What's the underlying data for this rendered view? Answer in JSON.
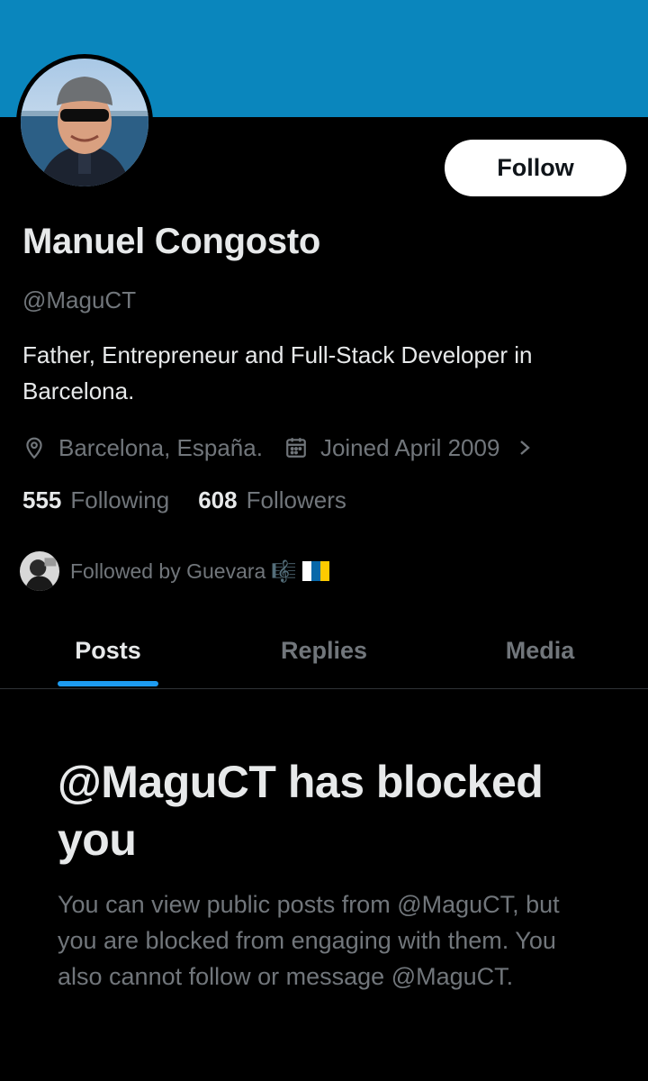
{
  "colors": {
    "banner": "#0a86bd",
    "accent": "#1d9bf0",
    "text_primary": "#e7e9ea",
    "text_secondary": "#71767b",
    "background": "#000000"
  },
  "profile": {
    "name": "Manuel Congosto",
    "handle": "@MaguCT",
    "bio": "Father, Entrepreneur and Full-Stack Developer in Barcelona.",
    "location_icon": "location-pin-icon",
    "location": "Barcelona, España.",
    "joined_icon": "calendar-icon",
    "joined": "Joined April 2009",
    "follow_label": "Follow"
  },
  "stats": {
    "following_count": "555",
    "following_label": "Following",
    "followers_count": "608",
    "followers_label": "Followers"
  },
  "followed_by": {
    "text": "Followed by Guevara",
    "emoji": "🎼"
  },
  "tabs": [
    {
      "label": "Posts",
      "active": true
    },
    {
      "label": "Replies",
      "active": false
    },
    {
      "label": "Media",
      "active": false
    }
  ],
  "blocked": {
    "title": "@MaguCT has blocked you",
    "message": "You can view public posts from @MaguCT, but you are blocked from engaging with them. You also cannot follow or message @MaguCT."
  }
}
